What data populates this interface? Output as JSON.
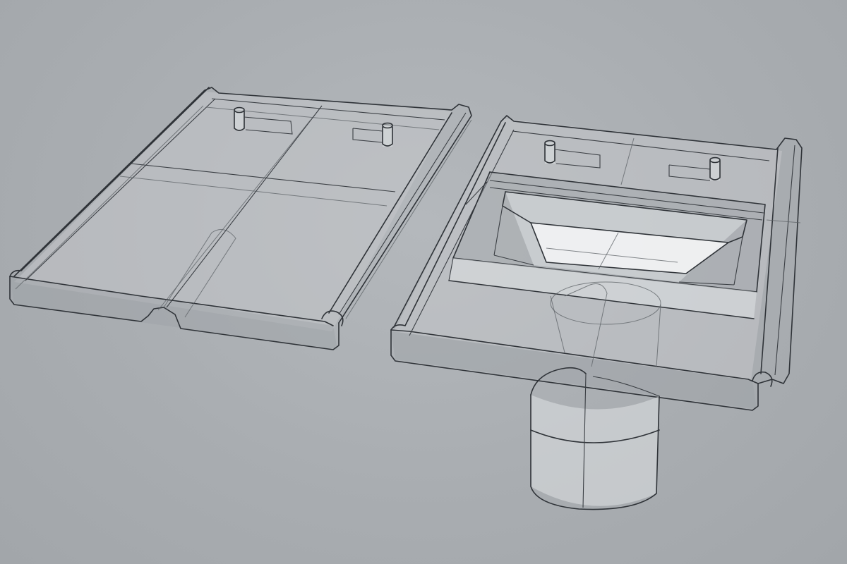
{
  "scene": {
    "background_color": "#a9adb1",
    "line_color": "#2f3338",
    "material_color": "#c4c7ca",
    "objects": [
      {
        "name": "flat-roof-tile",
        "pins": 2,
        "gutter_rolls": 2
      },
      {
        "name": "roof-tile-with-vent-outlet",
        "pins": 2,
        "gutter_rolls": 2,
        "has_funnel": true,
        "has_round_pipe": true
      }
    ]
  }
}
